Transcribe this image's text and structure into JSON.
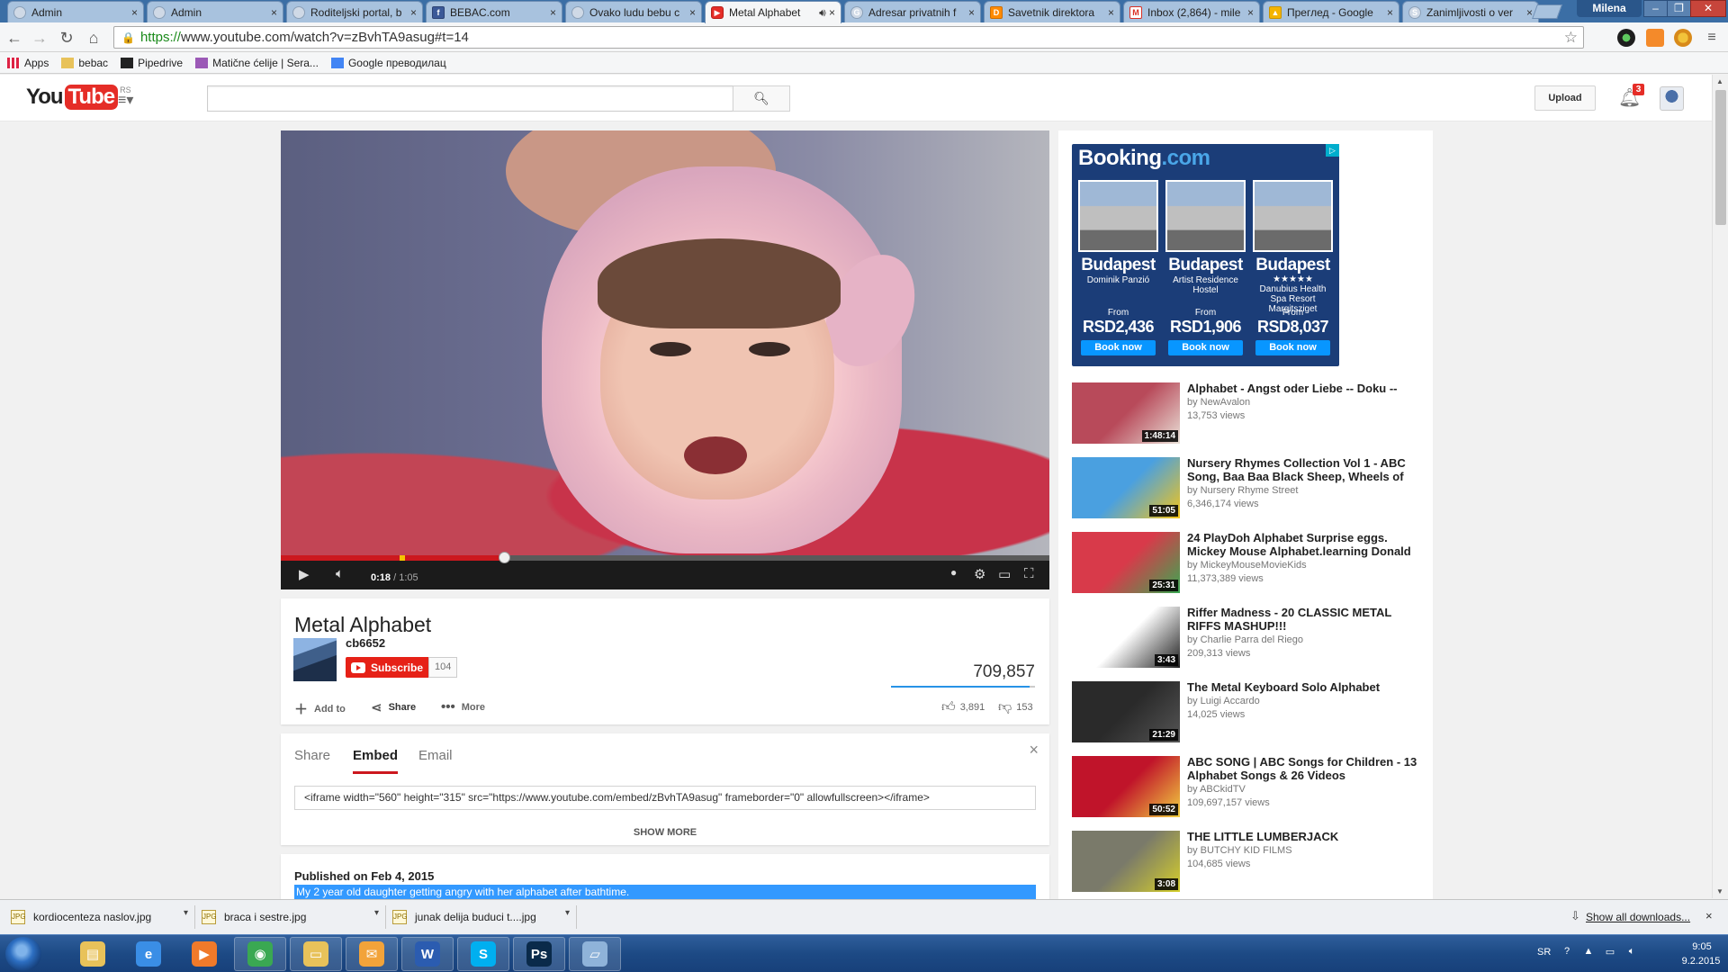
{
  "browser": {
    "tabs": [
      {
        "label": "Admin",
        "icon": "globe-icon"
      },
      {
        "label": "Admin",
        "icon": "globe-icon"
      },
      {
        "label": "Roditeljski portal, b",
        "icon": "globe-icon"
      },
      {
        "label": "BEBAC.com",
        "icon": "facebook-icon"
      },
      {
        "label": "Ovako ludu bebu c",
        "icon": "page-icon"
      },
      {
        "label": "Metal Alphabet",
        "icon": "youtube-icon",
        "active": true
      },
      {
        "label": "Adresar privatnih f",
        "icon": "google-icon"
      },
      {
        "label": "Savetnik direktora",
        "icon": "orange-icon"
      },
      {
        "label": "Inbox (2,864) - mile",
        "icon": "gmail-icon"
      },
      {
        "label": "Преглед - Google",
        "icon": "drive-icon"
      },
      {
        "label": "Zanimljivosti o ver",
        "icon": "s-icon"
      }
    ],
    "user_badge": "Milena",
    "url": {
      "scheme": "https://",
      "rest": "www.youtube.com/watch?v=zBvhTA9asug#t=14"
    },
    "bookmarks": [
      {
        "label": "Apps",
        "icon": "apps-grid-icon"
      },
      {
        "label": "bebac",
        "icon": "folder-icon"
      },
      {
        "label": "Pipedrive",
        "icon": "pipedrive-icon"
      },
      {
        "label": "Matične ćelije | Sera...",
        "icon": "cells-icon"
      },
      {
        "label": "Google преводилац",
        "icon": "translate-icon"
      }
    ]
  },
  "youtube": {
    "logo": {
      "you": "You",
      "tube": "Tube",
      "region": "RS"
    },
    "search_placeholder": "",
    "upload_label": "Upload",
    "notification_count": "3"
  },
  "video": {
    "current_time": "0:18",
    "separator": " / ",
    "duration": "1:05",
    "played_fraction": 0.29,
    "buffered_fraction": 0.29,
    "title": "Metal Alphabet",
    "channel": "cb6652",
    "subscribe_label": "Subscribe",
    "subscriber_count": "104",
    "view_count": "709,857",
    "like_fraction": 0.96,
    "actions": {
      "add_to": "Add to",
      "share": "Share",
      "more": "More"
    },
    "likes": "3,891",
    "dislikes": "153"
  },
  "embed": {
    "tabs": [
      "Share",
      "Embed",
      "Email"
    ],
    "active_tab": "Embed",
    "code": "<iframe width=\"560\" height=\"315\" src=\"https://www.youtube.com/embed/zBvhTA9asug\" frameborder=\"0\" allowfullscreen></iframe>",
    "show_more": "SHOW MORE"
  },
  "description": {
    "published": "Published on Feb 4, 2015",
    "text": "My 2 year old daughter getting angry with her alphabet after bathtime."
  },
  "ad": {
    "brand": "Booking",
    "brand_suffix": ".com",
    "hotels": [
      {
        "city": "Budapest",
        "name": "Dominik Panzió",
        "stars": "",
        "from": "From",
        "price": "RSD2,436",
        "cta": "Book now"
      },
      {
        "city": "Budapest",
        "name": "Artist Residence Hostel",
        "stars": "",
        "from": "From",
        "price": "RSD1,906",
        "cta": "Book now"
      },
      {
        "city": "Budapest",
        "name": "Danubius Health Spa Resort Margitsziget",
        "stars": "★★★★★",
        "from": "From",
        "price": "RSD8,037",
        "cta": "Book now"
      }
    ]
  },
  "related": [
    {
      "title": "Alphabet - Angst oder Liebe -- Doku --",
      "by": "by NewAvalon",
      "views": "13,753 views",
      "duration": "1:48:14",
      "thumb_colors": [
        "#b84a5a",
        "#e9e1d8"
      ]
    },
    {
      "title": "Nursery Rhymes Collection Vol 1 - ABC Song, Baa Baa Black Sheep, Wheels of",
      "by": "by Nursery Rhyme Street",
      "views": "6,346,174 views",
      "duration": "51:05",
      "thumb_colors": [
        "#4aa0e0",
        "#f5c518"
      ]
    },
    {
      "title": "24 PlayDoh Alphabet Surprise eggs. Mickey Mouse Alphabet.learning Donald",
      "by": "by MickeyMouseMovieKids",
      "views": "11,373,389 views",
      "duration": "25:31",
      "thumb_colors": [
        "#d83a4a",
        "#3aa852"
      ]
    },
    {
      "title": "Riffer Madness - 20 CLASSIC METAL RIFFS MASHUP!!!",
      "by": "by Charlie Parra del Riego",
      "views": "209,313 views",
      "duration": "3:43",
      "thumb_colors": [
        "#ffffff",
        "#1e1e1e"
      ]
    },
    {
      "title": "The Metal Keyboard Solo Alphabet",
      "by": "by Luigi Accardo",
      "views": "14,025 views",
      "duration": "21:29",
      "thumb_colors": [
        "#2a2a2a",
        "#555555"
      ]
    },
    {
      "title": "ABC SONG | ABC Songs for Children - 13 Alphabet Songs & 26 Videos",
      "by": "by ABCkidTV",
      "views": "109,697,157 views",
      "duration": "50:52",
      "thumb_colors": [
        "#c0142a",
        "#f2d040"
      ]
    },
    {
      "title": "THE LITTLE LUMBERJACK",
      "by": "by BUTCHY KID FILMS",
      "views": "104,685 views",
      "duration": "3:08",
      "thumb_colors": [
        "#7a7a6a",
        "#d6d02a"
      ]
    }
  ],
  "downloads": {
    "items": [
      "kordiocenteza naslov.jpg",
      "braca i sestre.jpg",
      "junak delija buduci t....jpg"
    ],
    "show_all": "Show all downloads...",
    "close": "×"
  },
  "taskbar": {
    "apps": [
      {
        "name": "explorer",
        "color": "#e8c25a",
        "open": false
      },
      {
        "name": "internet-explorer",
        "color": "#3a8ee6",
        "open": false
      },
      {
        "name": "media-player",
        "color": "#f07a2a",
        "open": false
      },
      {
        "name": "chrome",
        "color": "#3aa852",
        "open": true
      },
      {
        "name": "folder",
        "color": "#e8c25a",
        "open": true
      },
      {
        "name": "outlook",
        "color": "#f2a33a",
        "open": true
      },
      {
        "name": "word",
        "color": "#2b5cb0",
        "open": true
      },
      {
        "name": "skype",
        "color": "#00aff0",
        "open": true
      },
      {
        "name": "photoshop",
        "color": "#0a2a4a",
        "open": true
      },
      {
        "name": "notepad",
        "color": "#8fb3d9",
        "open": true
      }
    ],
    "language": "SR",
    "time": "9:05",
    "date": "9.2.2015"
  }
}
